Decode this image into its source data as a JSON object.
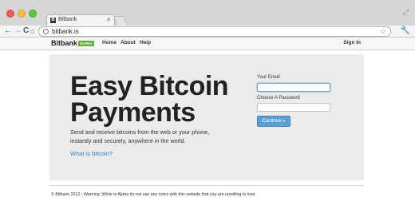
{
  "browser": {
    "tab_title": "Bitbank",
    "favicon_letter": "B",
    "url": "bitbank.is",
    "back_glyph": "←",
    "forward_glyph": "→",
    "reload_glyph": "C",
    "home_glyph": "⌂"
  },
  "site_nav": {
    "brand": "Bitbank",
    "badge": "ALPHA",
    "links": [
      "Home",
      "About",
      "Help"
    ],
    "sign_in": "Sign In"
  },
  "hero": {
    "title_line1": "Easy Bitcoin",
    "title_line2": "Payments",
    "subtitle": "Send and receive bitcoins from the web or your phone, instantly and securely, anywhere in the world.",
    "link": "What is bitcoin?"
  },
  "form": {
    "email_label": "Your Email",
    "email_value": "",
    "password_label": "Choose A Password",
    "password_value": "",
    "submit": "Continue »"
  },
  "footer": {
    "text": "© Bitbank 2012 - Warning: While in Alpha do not use any coins with this website that you are unwilling to lose."
  },
  "colors": {
    "badge": "#5fb137",
    "link": "#2f7fbf",
    "button": "#5b9fd4",
    "hero_bg": "#ebebeb"
  }
}
